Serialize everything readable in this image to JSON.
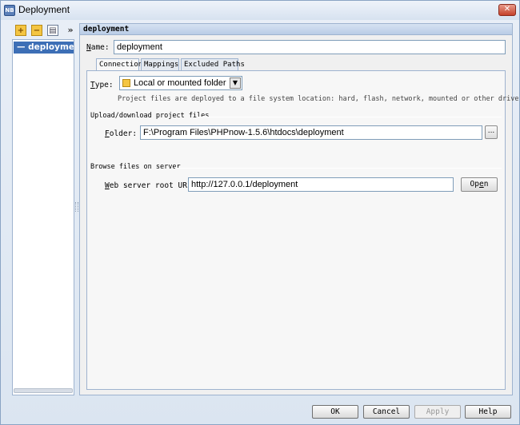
{
  "window": {
    "title": "Deployment",
    "close_label": "✕"
  },
  "toolbar": {
    "add_label": "+",
    "remove_label": "−",
    "more_label": "»"
  },
  "tree": {
    "items": [
      {
        "label": "— deployment"
      }
    ]
  },
  "panel": {
    "header": "deployment",
    "name_label_first": "N",
    "name_label_rest": "ame:",
    "name_value": "deployment",
    "tabs": [
      {
        "label": "Connection"
      },
      {
        "label": "Mappings"
      },
      {
        "label": "Excluded Paths"
      }
    ],
    "connection": {
      "type_label_first": "T",
      "type_label_rest": "ype:",
      "type_value": "Local or mounted folder",
      "type_description": "Project files are deployed to a file system location: hard, flash, network, mounted or other drive.",
      "upload_section": "Upload/download project files",
      "folder_label_first": "F",
      "folder_label_rest": "older:",
      "folder_value": "F:\\Program Files\\PHPnow-1.5.6\\htdocs\\deployment",
      "browse_label": "...",
      "browse_section": "Browse files on server",
      "url_label_first": "W",
      "url_label_rest": "eb server root URL:",
      "url_value": "http://127.0.0.1/deployment",
      "open_label_first": "Op",
      "open_label_underline": "e",
      "open_label_rest": "n"
    }
  },
  "buttons": {
    "ok": "OK",
    "cancel": "Cancel",
    "apply": "Apply",
    "help": "Help"
  }
}
